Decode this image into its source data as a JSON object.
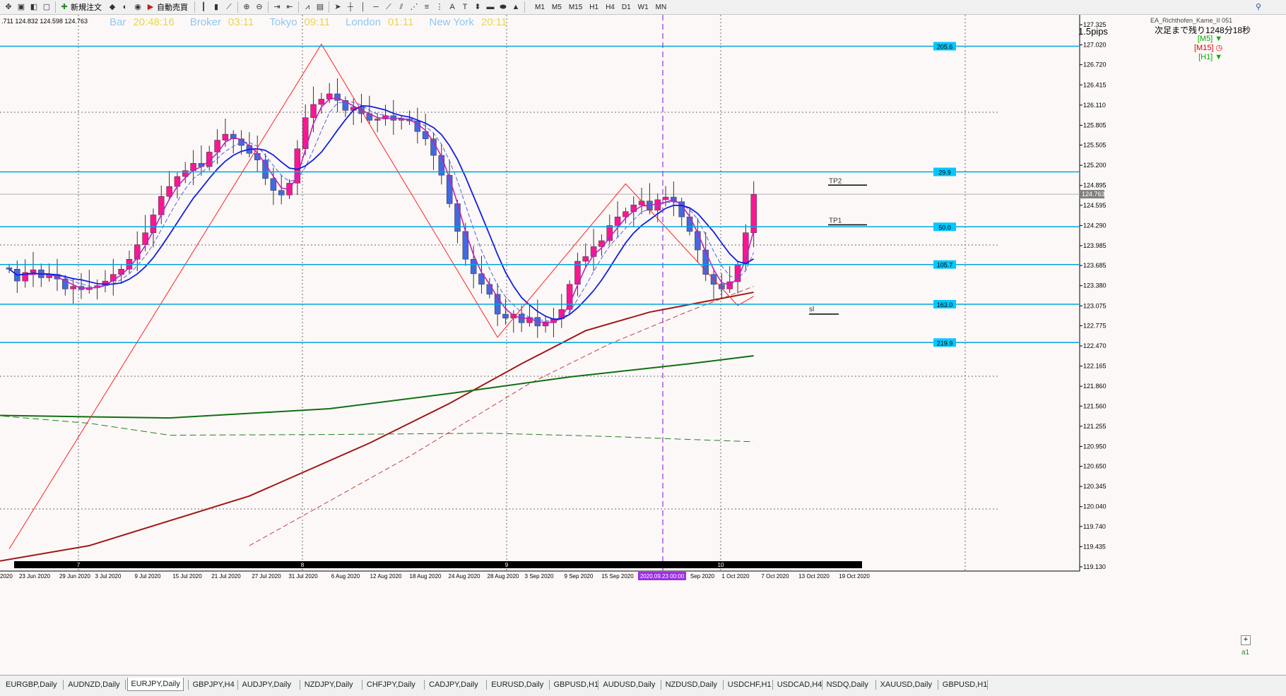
{
  "toolbar": {
    "new_order": "新規注文",
    "auto_trading": "自動売買",
    "timeframes": [
      "M1",
      "M5",
      "M15",
      "H1",
      "H4",
      "D1",
      "W1",
      "MN"
    ]
  },
  "chart": {
    "ohlc": ".711 124.832 124.598 124.763",
    "sessions": [
      {
        "label": "Bar",
        "time": "20:48:16"
      },
      {
        "label": "Broker",
        "time": "03:11"
      },
      {
        "label": "Tokyo",
        "time": "09:11"
      },
      {
        "label": "London",
        "time": "01:11"
      },
      {
        "label": "New York",
        "time": "20:11"
      }
    ],
    "ea_label": "EA_Richthofen_Kame_II 051",
    "spread": "1.5pips",
    "countdown": "次足まで残り1248分18秒",
    "tf_signals": [
      {
        "tf": "[M5]",
        "color": "#00b000",
        "icon": "triangle-down-icon"
      },
      {
        "tf": "[M15]",
        "color": "#e00000",
        "icon": "clock-icon"
      },
      {
        "tf": "[H1]",
        "color": "#00b000",
        "icon": "triangle-down-icon"
      }
    ],
    "current_price": "124.763",
    "price_axis": [
      "127.325",
      "127.020",
      "126.720",
      "126.415",
      "126.110",
      "125.805",
      "125.505",
      "125.200",
      "124.895",
      "124.595",
      "124.290",
      "123.985",
      "123.685",
      "123.380",
      "123.075",
      "122.775",
      "122.470",
      "122.165",
      "121.860",
      "121.560",
      "121.255",
      "120.950",
      "120.650",
      "120.345",
      "120.040",
      "119.740",
      "119.435",
      "119.130"
    ],
    "date_axis": [
      "2020",
      "23 Jun 2020",
      "29 Jun 2020",
      "3 Jul 2020",
      "9 Jul 2020",
      "15 Jul 2020",
      "21 Jul 2020",
      "27 Jul 2020",
      "31 Jul 2020",
      "6 Aug 2020",
      "12 Aug 2020",
      "18 Aug 2020",
      "24 Aug 2020",
      "28 Aug 2020",
      "3 Sep 2020",
      "9 Sep 2020",
      "15 Sep 2020",
      "2020.09.23 00:00",
      "Sep 2020",
      "1 Oct 2020",
      "7 Oct 2020",
      "13 Oct 2020",
      "19 Oct 2020"
    ],
    "month_marks": [
      "7",
      "8",
      "9",
      "10"
    ],
    "fib_levels": [
      {
        "label": "205.6",
        "price": 127.0
      },
      {
        "label": "29.9",
        "price": 125.1
      },
      {
        "label": "50.0",
        "price": 124.27
      },
      {
        "label": "105.7",
        "price": 123.7
      },
      {
        "label": "163.0",
        "price": 123.1
      },
      {
        "label": "219.9",
        "price": 122.52
      }
    ],
    "tp2_label": "TP2",
    "tp1_label": "TP1",
    "sl_label": "sl",
    "zoom_plus": "+",
    "a1_label": "a1",
    "colors": {
      "bull": "#ff1493",
      "bear": "#4169e1",
      "fib": "#00a5e0",
      "grid": "#7a7a7a"
    }
  },
  "tabs": [
    "EURGBP,Daily",
    "AUDNZD,Daily",
    "EURJPY,Daily",
    "GBPJPY,H4",
    "AUDJPY,Daily",
    "NZDJPY,Daily",
    "CHFJPY,Daily",
    "CADJPY,Daily",
    "EURUSD,Daily",
    "GBPUSD,H1",
    "AUDUSD,Daily",
    "NZDUSD,Daily",
    "USDCHF,H1",
    "USDCAD,H4",
    "NSDQ,Daily",
    "XAUUSD,Daily",
    "GBPUSD,H1"
  ],
  "active_tab": "EURJPY,Daily"
}
